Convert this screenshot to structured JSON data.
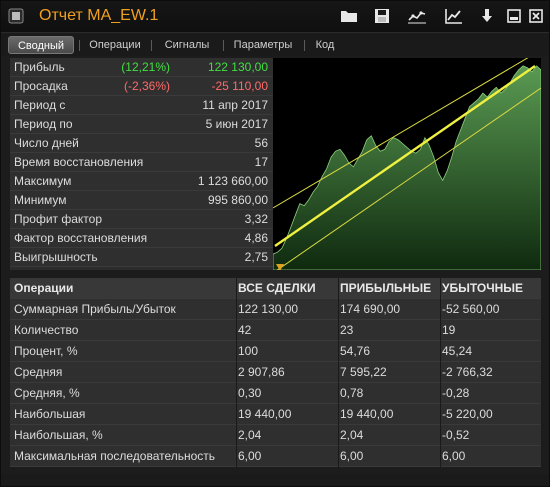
{
  "window": {
    "title": "Отчет MA_EW.1",
    "accent_color": "#f0a020"
  },
  "toolbar": {
    "buttons": [
      {
        "name": "open-folder-icon"
      },
      {
        "name": "save-icon"
      },
      {
        "name": "chart-settings-icon"
      },
      {
        "name": "equity-chart-icon"
      },
      {
        "name": "download-icon"
      },
      {
        "name": "minimize-icon"
      },
      {
        "name": "close-icon"
      }
    ]
  },
  "tabs": [
    {
      "label": "Сводный",
      "active": true
    },
    {
      "label": "Операции",
      "active": false
    },
    {
      "label": "Сигналы",
      "active": false
    },
    {
      "label": "Параметры",
      "active": false
    },
    {
      "label": "Код",
      "active": false
    }
  ],
  "summary": [
    {
      "label": "Прибыль",
      "pct": "(12,21%)",
      "value": "122 130,00",
      "color": "green"
    },
    {
      "label": "Просадка",
      "pct": "(-2,36%)",
      "value": "-25 110,00",
      "color": "red"
    },
    {
      "label": "Период с",
      "pct": "",
      "value": "11 апр 2017",
      "color": ""
    },
    {
      "label": "Период по",
      "pct": "",
      "value": "5 июн 2017",
      "color": ""
    },
    {
      "label": "Число дней",
      "pct": "",
      "value": "56",
      "color": ""
    },
    {
      "label": "Время восстановления",
      "pct": "",
      "value": "17",
      "color": ""
    },
    {
      "label": "Максимум",
      "pct": "",
      "value": "1 123 660,00",
      "color": ""
    },
    {
      "label": "Минимум",
      "pct": "",
      "value": "995 860,00",
      "color": ""
    },
    {
      "label": "Профит фактор",
      "pct": "",
      "value": "3,32",
      "color": ""
    },
    {
      "label": "Фактор восстановления",
      "pct": "",
      "value": "4,86",
      "color": ""
    },
    {
      "label": "Выигрышность",
      "pct": "",
      "value": "2,75",
      "color": ""
    }
  ],
  "equity_curve": [
    0.02,
    0.03,
    0.05,
    0.1,
    0.16,
    0.22,
    0.28,
    0.27,
    0.3,
    0.34,
    0.37,
    0.42,
    0.46,
    0.52,
    0.55,
    0.56,
    0.53,
    0.49,
    0.47,
    0.51,
    0.55,
    0.61,
    0.63,
    0.58,
    0.55,
    0.56,
    0.6,
    0.62,
    0.61,
    0.59,
    0.57,
    0.55,
    0.54,
    0.56,
    0.62,
    0.58,
    0.52,
    0.44,
    0.4,
    0.45,
    0.52,
    0.6,
    0.66,
    0.72,
    0.78,
    0.8,
    0.82,
    0.85,
    0.83,
    0.86,
    0.88,
    0.85,
    0.87,
    0.9,
    0.94,
    0.97,
    0.99,
    0.98,
    0.96,
    0.99,
    0.97
  ],
  "stats": {
    "headers": [
      "Операции",
      "ВСЕ СДЕЛКИ",
      "ПРИБЫЛЬНЫЕ",
      "УБЫТОЧНЫЕ"
    ],
    "rows": [
      [
        "Суммарная Прибыль/Убыток",
        "122 130,00",
        "174 690,00",
        "-52 560,00"
      ],
      [
        "Количество",
        "42",
        "23",
        "19"
      ],
      [
        "Процент, %",
        "100",
        "54,76",
        "45,24"
      ],
      [
        "Средняя",
        "2 907,86",
        "7 595,22",
        "-2 766,32"
      ],
      [
        "Средняя, %",
        "0,30",
        "0,78",
        "-0,28"
      ],
      [
        "Наибольшая",
        "19 440,00",
        "19 440,00",
        "-5 220,00"
      ],
      [
        "Наибольшая, %",
        "2,04",
        "2,04",
        "-0,52"
      ],
      [
        "Максимальная последовательность",
        "6,00",
        "6,00",
        "6,00"
      ]
    ]
  }
}
